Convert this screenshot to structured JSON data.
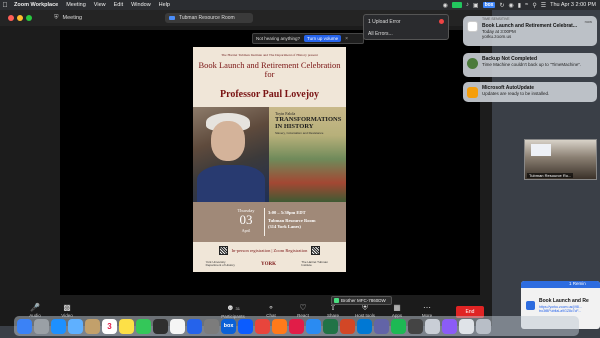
{
  "menubar": {
    "app_name": "Zoom Workplace",
    "items": [
      "Meeting",
      "View",
      "Edit",
      "Window",
      "Help"
    ],
    "tray_box": "box",
    "clock": "Thu Apr 3  2:00 PM"
  },
  "zoom": {
    "window_title": "Meeting",
    "room_pill": "Tubman Resource Room",
    "hearing": {
      "question": "Not hearing anything?",
      "button": "Turn up volume"
    },
    "toolbar": {
      "audio": "Audio",
      "video": "Video",
      "participants": "Participants",
      "participants_count": "31",
      "chat": "Chat",
      "react": "React",
      "share": "Share",
      "host_tools": "Host tools",
      "apps": "Apps",
      "more": "More",
      "end": "End",
      "printer_toast": "Brother MFC-7860DW"
    }
  },
  "poster": {
    "org": "The Harriet Tubman Institute and The Department of History present",
    "heading": "Book Launch and Retirement Celebration for",
    "honoree": "Professor Paul Lovejoy",
    "book_author": "Toyin Falola",
    "book_title": "TRANSFORMATIONS IN HISTORY",
    "book_subtitle": "Slavery, Colonialism and Resistance",
    "day": "Thursday",
    "date": "03",
    "month": "April",
    "time": "3:00 – 5:30pm EDT",
    "venue_line1": "Tubman Resource Room",
    "venue_line2": "(314 York Lanes)",
    "registration": "In-person registration  |  Zoom Registration",
    "logo_left": "York University Department of History",
    "logo_york": "YORK",
    "logo_right": "The Harriet Tubman Institute"
  },
  "upload_popup": {
    "title": "1 Upload Error",
    "all_errors": "All Errors..."
  },
  "notifications": [
    {
      "header": "TIME SENSITIVE",
      "time": "now",
      "title": "Book Launch and Retirement Celebrat...",
      "body_line1": "Today at 3:00PM",
      "body_line2": "yorku.zoom.us"
    },
    {
      "title": "Backup Not Completed",
      "body": "Time Machine couldn't back up to \"TimeMachine\"."
    },
    {
      "title": "Microsoft AutoUpdate",
      "body": "Updates are ready to be installed."
    }
  ],
  "video_tile": {
    "name": "Tubman Resource Ro..."
  },
  "zoom_card": {
    "header": "1 Remin",
    "title": "Book Launch and Re",
    "link": "https://yorku.zoom.us/j/98... tro3tBPubfiaLa9GZ8c7cF..."
  },
  "dock": {
    "calendar_date": "3",
    "box_label": "box"
  },
  "colors": {
    "poster_red": "#7a1414",
    "zoom_blue": "#2563eb",
    "end_red": "#e02424"
  }
}
